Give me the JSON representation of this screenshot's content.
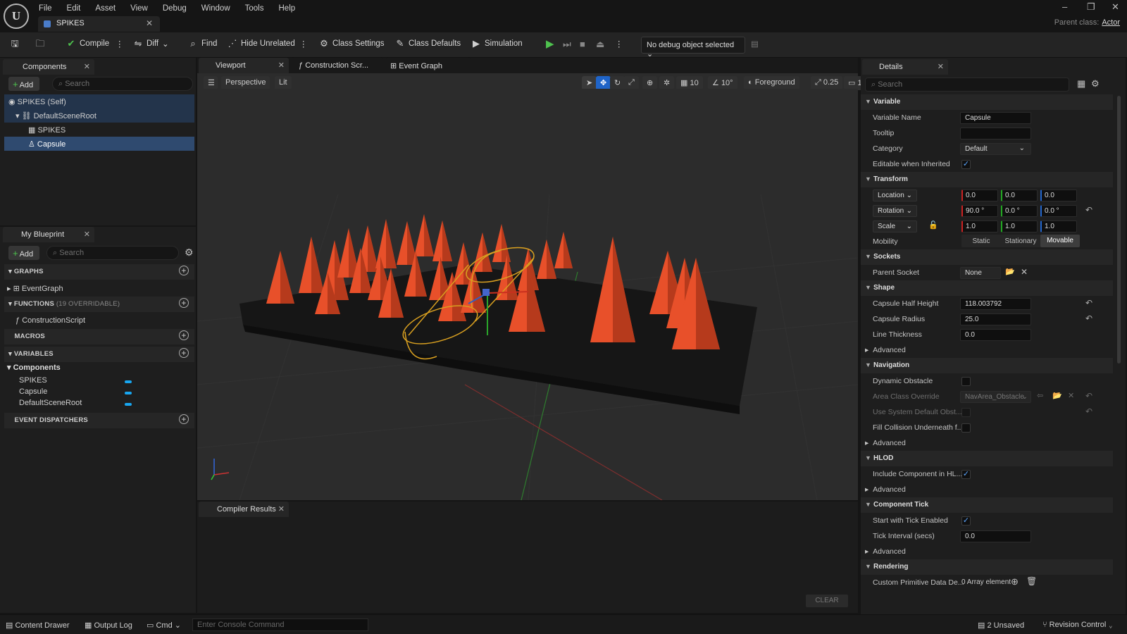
{
  "app": {
    "logo_text": "U",
    "menu": [
      "File",
      "Edit",
      "Asset",
      "View",
      "Debug",
      "Window",
      "Tools",
      "Help"
    ],
    "doc_tab": "SPIKES",
    "parent_label": "Parent class:",
    "parent_value": "Actor"
  },
  "toolbar": {
    "compile": "Compile",
    "diff": "Diff",
    "find": "Find",
    "hide_unrelated": "Hide Unrelated",
    "class_settings": "Class Settings",
    "class_defaults": "Class Defaults",
    "simulation": "Simulation",
    "debug_object": "No debug object selected"
  },
  "components": {
    "tab": "Components",
    "add": "Add",
    "search_placeholder": "Search",
    "tree": [
      "SPIKES (Self)",
      "DefaultSceneRoot",
      "SPIKES",
      "Capsule"
    ]
  },
  "blueprint": {
    "tab": "My Blueprint",
    "add": "Add",
    "search_placeholder": "Search",
    "graphs": "GRAPHS",
    "event_graph": "EventGraph",
    "functions": "FUNCTIONS",
    "functions_count": "(19 OVERRIDABLE)",
    "construction_script": "ConstructionScript",
    "macros": "MACROS",
    "variables": "VARIABLES",
    "components_group": "Components",
    "variable_items": [
      "SPIKES",
      "Capsule",
      "DefaultSceneRoot"
    ],
    "event_dispatchers": "EVENT DISPATCHERS"
  },
  "viewport": {
    "tabs": [
      "Viewport",
      "Construction Scr...",
      "Event Graph"
    ],
    "perspective": "Perspective",
    "lit": "Lit",
    "grid_snap": "10",
    "rot_snap": "10°",
    "foreground": "Foreground",
    "scale_snap": "0.25",
    "cam": "1"
  },
  "compiler": {
    "tab": "Compiler Results",
    "clear": "CLEAR"
  },
  "details": {
    "tab": "Details",
    "search_placeholder": "Search",
    "variable": {
      "title": "Variable",
      "name_label": "Variable Name",
      "name": "Capsule",
      "tooltip_label": "Tooltip",
      "category_label": "Category",
      "category": "Default",
      "editable_label": "Editable when Inherited"
    },
    "transform": {
      "title": "Transform",
      "location": "Location",
      "rotation": "Rotation",
      "scale": "Scale",
      "loc": [
        "0.0",
        "0.0",
        "0.0"
      ],
      "rot": [
        "90.0 °",
        "0.0 °",
        "0.0 °"
      ],
      "scl": [
        "1.0",
        "1.0",
        "1.0"
      ],
      "mobility_label": "Mobility",
      "mobility": [
        "Static",
        "Stationary",
        "Movable"
      ]
    },
    "sockets": {
      "title": "Sockets",
      "parent_label": "Parent Socket",
      "parent": "None"
    },
    "shape": {
      "title": "Shape",
      "half_height_label": "Capsule Half Height",
      "half_height": "118.003792",
      "radius_label": "Capsule Radius",
      "radius": "25.0",
      "thickness_label": "Line Thickness",
      "thickness": "0.0",
      "advanced": "Advanced"
    },
    "navigation": {
      "title": "Navigation",
      "dynamic_label": "Dynamic Obstacle",
      "area_label": "Area Class Override",
      "area": "NavArea_Obstacle",
      "system_label": "Use System Default Obst...",
      "fill_label": "Fill Collision Underneath f...",
      "advanced": "Advanced"
    },
    "hlod": {
      "title": "HLOD",
      "include_label": "Include Component in HL...",
      "advanced": "Advanced"
    },
    "tick": {
      "title": "Component Tick",
      "start_label": "Start with Tick Enabled",
      "interval_label": "Tick Interval (secs)",
      "interval": "0.0",
      "advanced": "Advanced"
    },
    "rendering": {
      "title": "Rendering",
      "custom_label": "Custom Primitive Data De...",
      "custom": "0 Array element"
    }
  },
  "statusbar": {
    "content_drawer": "Content Drawer",
    "output_log": "Output Log",
    "cmd": "Cmd",
    "console_placeholder": "Enter Console Command",
    "unsaved": "2 Unsaved",
    "revision": "Revision Control"
  },
  "colors": {
    "accent": "#18a6f0",
    "selection": "#2f4a6f",
    "play": "#4ec24e",
    "spike": "#e8502a"
  }
}
